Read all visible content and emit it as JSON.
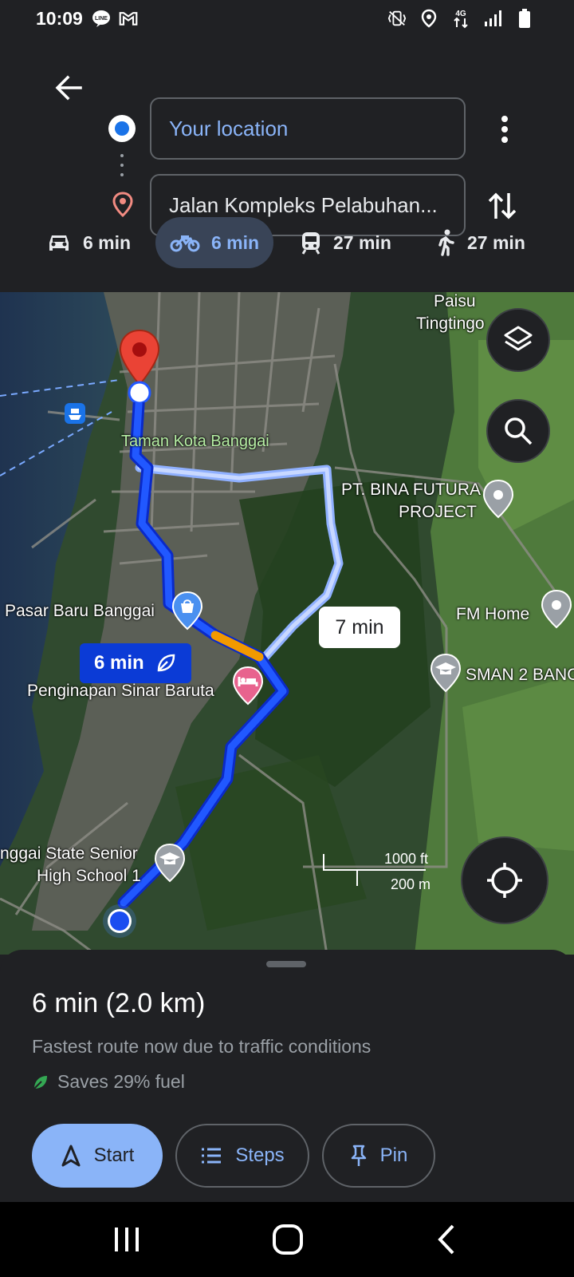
{
  "status_bar": {
    "time": "10:09",
    "left_icons": [
      "line-icon",
      "gmail-icon"
    ],
    "right_icons": [
      "vibrate-icon",
      "location-icon",
      "4g-data-icon",
      "signal-icon",
      "battery-icon"
    ],
    "network": "4G"
  },
  "directions": {
    "origin": "Your location",
    "destination": "Jalan Kompleks Pelabuhan..."
  },
  "modes": [
    {
      "name": "drive",
      "time": "6 min"
    },
    {
      "name": "motorcycle",
      "time": "6 min",
      "active": true
    },
    {
      "name": "transit",
      "time": "27 min"
    },
    {
      "name": "walk",
      "time": "27 min"
    }
  ],
  "map": {
    "labels": {
      "paisu": "Paisu",
      "tingtingo": "Tingtingo",
      "taman": "Taman Kota Banggai",
      "pt_bina1": "PT. BINA FUTURA",
      "pt_bina2": "PROJECT",
      "fm_home": "FM Home",
      "pasar": "Pasar Baru Banggai",
      "sman": "SMAN 2 BANG",
      "penginapan": "Penginapan Sinar Baruta",
      "school1": "nggai State Senior",
      "school2": "High School 1"
    },
    "route_badge": "6 min",
    "alt_badge": "7 min",
    "scale": {
      "ft": "1000 ft",
      "m": "200 m"
    }
  },
  "sheet": {
    "time": "6 min (2.0 km)",
    "description": "Fastest route now due to traffic conditions",
    "fuel": "Saves 29% fuel",
    "start_label": "Start",
    "steps_label": "Steps",
    "pin_label": "Pin"
  },
  "colors": {
    "accent": "#8ab4f8",
    "route": "#1a4df0",
    "alt_route": "#a8c2ff",
    "traffic": "#f29900",
    "background": "#202124"
  }
}
